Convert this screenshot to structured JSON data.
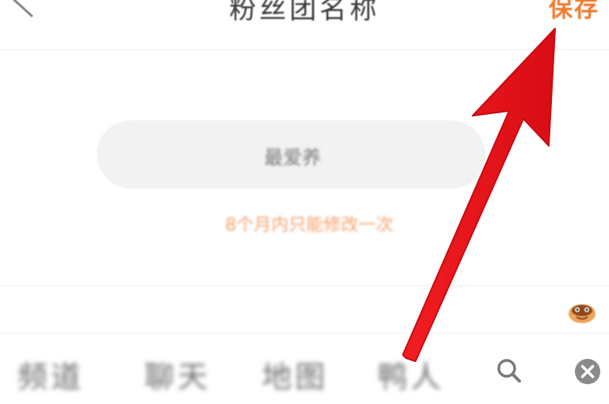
{
  "header": {
    "title": "粉丝团名称",
    "save_label": "保存"
  },
  "name_input": {
    "value": "最爱养"
  },
  "hint": {
    "text": "8个月内只能修改一次"
  },
  "tabs": [
    {
      "label": "频道"
    },
    {
      "label": "聊天"
    },
    {
      "label": "地图"
    },
    {
      "label": "鸭人"
    }
  ],
  "icons": {
    "back": "chevron-left-icon",
    "search": "search-icon",
    "clear": "clear-circle-icon",
    "emoji": "emoji-icon"
  },
  "colors": {
    "accent": "#f07a2e",
    "hint": "#f3a06b",
    "arrow": "#e8141a"
  }
}
